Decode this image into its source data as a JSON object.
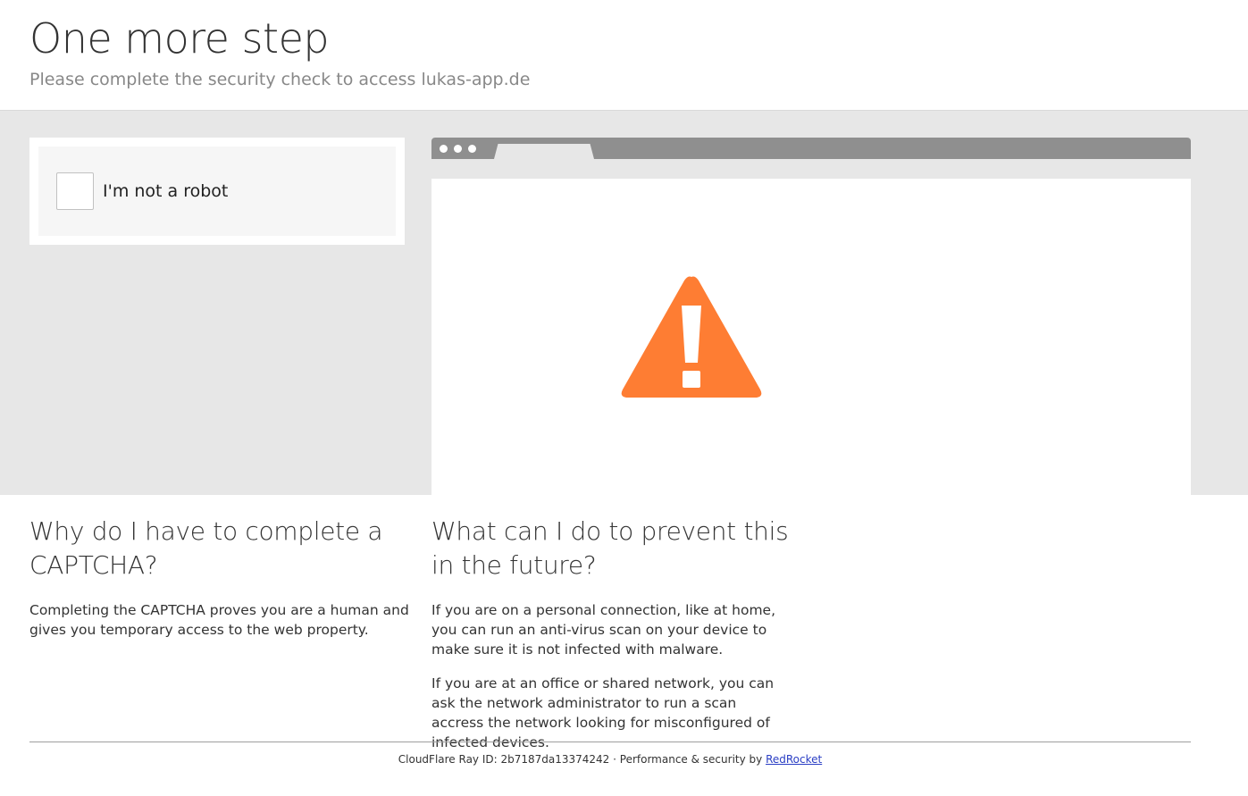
{
  "header": {
    "title": "One more step",
    "subtitle": "Please complete the security check to access lukas-app.de"
  },
  "captcha": {
    "label": "I'm not a robot"
  },
  "illustration": {
    "icon": "warning-triangle-icon",
    "accent_color": "#fe7d33",
    "bar_color": "#8f8f8f"
  },
  "why": {
    "heading": "Why do I have to complete a CAPTCHA?",
    "paragraphs": [
      "Completing the CAPTCHA proves you are a human and gives you temporary access to the web property."
    ]
  },
  "prevent": {
    "heading": "What can I do to prevent this in the future?",
    "paragraphs": [
      "If you are on a personal connection, like at home, you can run an anti-virus scan on your device to make sure it is not infected with malware.",
      "If you are at an office or shared network, you can ask the network administrator to run a scan accress the network looking for misconfigured of infected devices."
    ]
  },
  "footer": {
    "ray_text": "CloudFlare Ray ID: 2b7187da13374242 · Performance & security by ",
    "link_text": "RedRocket"
  }
}
